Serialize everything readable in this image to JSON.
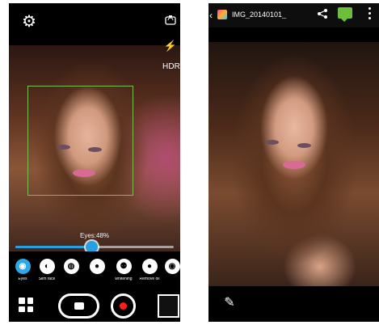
{
  "camera_screen": {
    "top_icons": {
      "settings": "settings-icon",
      "switch_camera": "switch-camera-icon",
      "flash": "flash-auto-icon"
    },
    "hdr_label": "HDR",
    "slider": {
      "label": "Eyes:48%",
      "value": 0.48
    },
    "tools": [
      {
        "label": "Eyes",
        "icon": "eye-icon",
        "active": true
      },
      {
        "label": "Slim face",
        "icon": "face-slim-icon",
        "active": false
      },
      {
        "label": "",
        "icon": "brush-icon",
        "active": false
      },
      {
        "label": "",
        "icon": "lipstick-icon",
        "active": false
      },
      {
        "label": "whitening",
        "icon": "tooth-icon",
        "active": false
      },
      {
        "label": "Remove oil",
        "icon": "drop-icon",
        "active": false
      },
      {
        "label": "",
        "icon": "eye-makeup-icon",
        "active": false
      }
    ],
    "bottom_controls": {
      "gallery_grid": "grid-icon",
      "photo_button": "camera-icon",
      "record_button": "record-icon",
      "thumbnail": "gallery-thumbnail"
    },
    "colors": {
      "accent": "#2a9fe0",
      "face_box": "#7dbd4f",
      "record": "#ff1c1c"
    }
  },
  "viewer_screen": {
    "top_bar": {
      "back_icon": "back-icon",
      "app_icon": "gallery-app-icon",
      "file_name": "IMG_20140101_",
      "share_icon": "share-icon",
      "comment_icon": "comment-icon",
      "more_icon": "more-icon"
    },
    "bottom_bar": {
      "edit_icon": "pencil-icon"
    }
  }
}
